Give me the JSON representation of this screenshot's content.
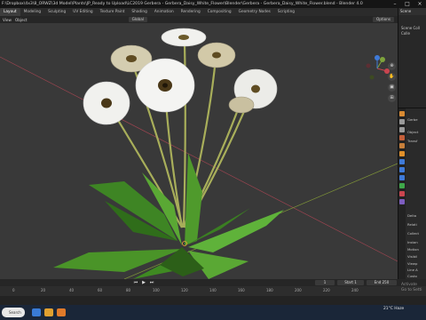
{
  "window": {
    "title": "F:\\Dropbox\\4x3\\8_ORWZ\\3d Model\\Plants\\JP_Ready to Upload\\LC2019 Gerbera - Gerbera_Daisy_White_Flower\\Blender\\Gerbera - Gerbera_Daisy_White_Flower.blend - Blender 4.0",
    "minimize": "–",
    "maximize": "□",
    "close": "×"
  },
  "workspace_tabs": [
    "Layout",
    "Modeling",
    "Sculpting",
    "UV Editing",
    "Texture Paint",
    "Shading",
    "Animation",
    "Rendering",
    "Compositing",
    "Geometry Nodes",
    "Scripting"
  ],
  "viewport_header": {
    "menu_view": "View",
    "menu_object": "Object",
    "orientation": "Global",
    "options": "Options"
  },
  "outliner": {
    "title": "Scene",
    "rows": [
      "Scene Coll",
      "Colle"
    ]
  },
  "properties": {
    "rows": [
      "Gerbe",
      "Object",
      "Transf",
      "Delta",
      "Relati",
      "Collect",
      "Instan",
      "Motion",
      "Visibil",
      "Viewp",
      "Line A",
      "Custo"
    ]
  },
  "timeline": {
    "current_frame": "1",
    "start_label": "Start",
    "start": "1",
    "end_label": "End",
    "end": "250",
    "ticks": [
      "0",
      "20",
      "40",
      "60",
      "80",
      "100",
      "120",
      "140",
      "160",
      "180",
      "200",
      "220",
      "240"
    ]
  },
  "activation_watermark": {
    "line1": "Activate",
    "line2": "Go to Setti"
  },
  "taskbar": {
    "search_placeholder": "Search",
    "weather": "21°C  Haze"
  },
  "colors": {
    "viewport_bg": "#393939",
    "x_axis": "#9c4450",
    "y_axis": "#7f9438",
    "active_tab": "#3d3d3d",
    "petal": "#f1f1ee",
    "leaf": "#4f9a2c"
  }
}
